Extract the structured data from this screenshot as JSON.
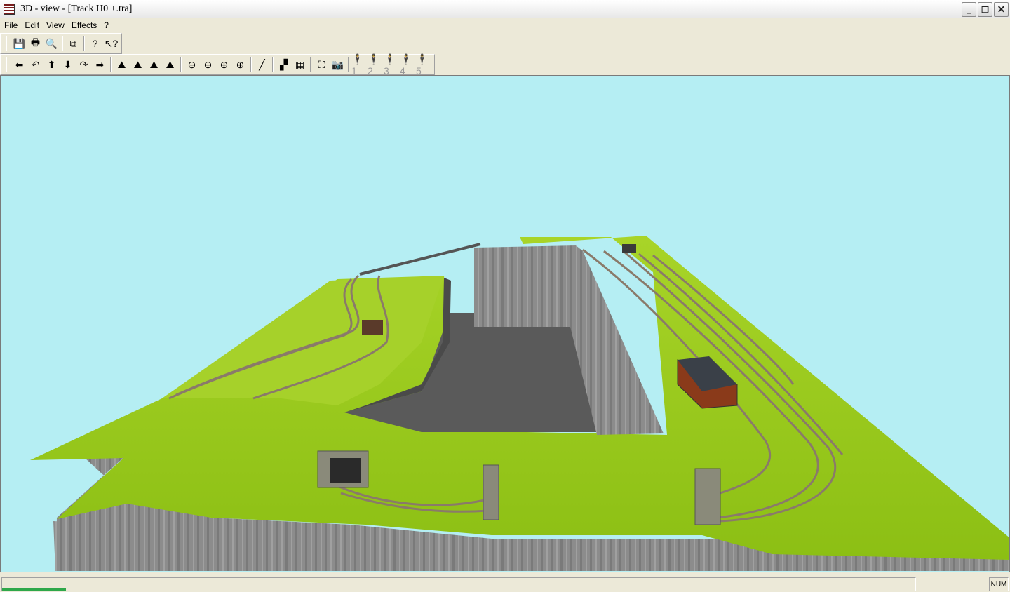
{
  "window": {
    "title": "3D - view - [Track H0 +.tra]",
    "buttons": {
      "minimize": "_",
      "maximize": "❐",
      "close": "✕"
    }
  },
  "menu": [
    {
      "label": "File"
    },
    {
      "label": "Edit"
    },
    {
      "label": "View"
    },
    {
      "label": "Effects"
    },
    {
      "label": "?"
    }
  ],
  "toolbar1": [
    {
      "icon": "save-icon",
      "glyph": "💾"
    },
    {
      "icon": "print-icon",
      "glyph": "🖶"
    },
    {
      "icon": "print-preview-icon",
      "glyph": "🔍"
    },
    {
      "icon": "copy-icon",
      "glyph": "⧉"
    },
    {
      "icon": "help-icon",
      "glyph": "?"
    },
    {
      "icon": "context-help-icon",
      "glyph": "↖?"
    }
  ],
  "toolbar2": [
    {
      "icon": "move-left-icon",
      "glyph": "⬅"
    },
    {
      "icon": "rotate-left-icon",
      "glyph": "↶"
    },
    {
      "icon": "move-up-icon",
      "glyph": "⬆"
    },
    {
      "icon": "move-down-icon",
      "glyph": "⬇"
    },
    {
      "icon": "rotate-right-icon",
      "glyph": "↷"
    },
    {
      "icon": "move-right-icon",
      "glyph": "➡"
    },
    {
      "icon": "camera-tilt-up-icon",
      "glyph": "⛰"
    },
    {
      "icon": "camera-raise-icon",
      "glyph": "⛰"
    },
    {
      "icon": "camera-lower-icon",
      "glyph": "⛰"
    },
    {
      "icon": "camera-tilt-down-icon",
      "glyph": "⛰"
    },
    {
      "icon": "zoom-out-more-icon",
      "glyph": "⊖"
    },
    {
      "icon": "zoom-out-icon",
      "glyph": "⊖"
    },
    {
      "icon": "zoom-in-icon",
      "glyph": "⊕"
    },
    {
      "icon": "zoom-in-more-icon",
      "glyph": "⊕"
    },
    {
      "icon": "track-icon",
      "glyph": "╱"
    },
    {
      "icon": "terrain-icon",
      "glyph": "▞"
    },
    {
      "icon": "grid-icon",
      "glyph": "▦"
    },
    {
      "icon": "fit-view-icon",
      "glyph": "⛶"
    },
    {
      "icon": "snapshot-icon",
      "glyph": "📷"
    },
    {
      "icon": "camera-1-icon",
      "glyph": "🕴1",
      "disabled": true
    },
    {
      "icon": "camera-2-icon",
      "glyph": "🕴2",
      "disabled": true
    },
    {
      "icon": "camera-3-icon",
      "glyph": "🕴3",
      "disabled": true
    },
    {
      "icon": "camera-4-icon",
      "glyph": "🕴4",
      "disabled": true
    },
    {
      "icon": "camera-5-icon",
      "glyph": "🕴5",
      "disabled": true
    }
  ],
  "status": {
    "main": "",
    "num": "NUM",
    "progress_fraction": 0.07
  },
  "colors": {
    "sky": "#b5eef3",
    "grass": "#9acd1e",
    "rock": "#6e6e6e",
    "track": "#8a7a6a"
  }
}
